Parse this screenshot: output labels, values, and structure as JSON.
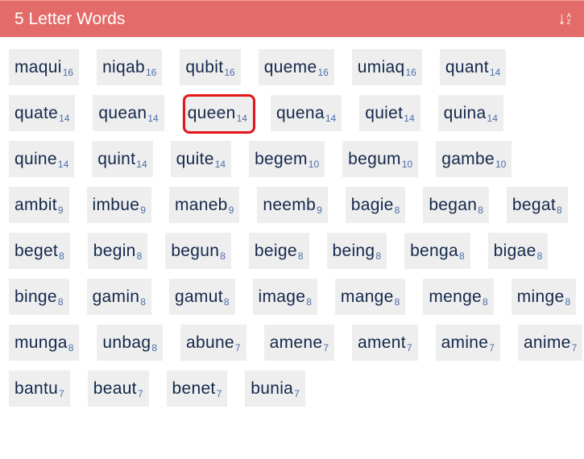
{
  "header": {
    "title": "5 Letter Words",
    "sort_icon": "sort-az-icon",
    "sort_glyph": "↓",
    "sort_letters": [
      "A",
      "Z"
    ]
  },
  "colors": {
    "header_bg": "#e36b69",
    "tile_bg": "#eeeeee",
    "word_text": "#14284b",
    "score_text": "#4b6ea8",
    "highlight": "#e4161b"
  },
  "highlighted_word": "queen",
  "words": [
    {
      "w": "maqui",
      "s": "16"
    },
    {
      "w": "niqab",
      "s": "16"
    },
    {
      "w": "qubit",
      "s": "16"
    },
    {
      "w": "queme",
      "s": "16"
    },
    {
      "w": "umiaq",
      "s": "16"
    },
    {
      "w": "quant",
      "s": "14"
    },
    {
      "w": "quate",
      "s": "14"
    },
    {
      "w": "quean",
      "s": "14"
    },
    {
      "w": "queen",
      "s": "14"
    },
    {
      "w": "quena",
      "s": "14"
    },
    {
      "w": "quiet",
      "s": "14"
    },
    {
      "w": "quina",
      "s": "14"
    },
    {
      "w": "quine",
      "s": "14"
    },
    {
      "w": "quint",
      "s": "14"
    },
    {
      "w": "quite",
      "s": "14"
    },
    {
      "w": "begem",
      "s": "10"
    },
    {
      "w": "begum",
      "s": "10"
    },
    {
      "w": "gambe",
      "s": "10"
    },
    {
      "w": "ambit",
      "s": "9"
    },
    {
      "w": "imbue",
      "s": "9"
    },
    {
      "w": "maneb",
      "s": "9"
    },
    {
      "w": "neemb",
      "s": "9"
    },
    {
      "w": "bagie",
      "s": "8"
    },
    {
      "w": "began",
      "s": "8"
    },
    {
      "w": "begat",
      "s": "8"
    },
    {
      "w": "beget",
      "s": "8"
    },
    {
      "w": "begin",
      "s": "8"
    },
    {
      "w": "begun",
      "s": "8"
    },
    {
      "w": "beige",
      "s": "8"
    },
    {
      "w": "being",
      "s": "8"
    },
    {
      "w": "benga",
      "s": "8"
    },
    {
      "w": "bigae",
      "s": "8"
    },
    {
      "w": "binge",
      "s": "8"
    },
    {
      "w": "gamin",
      "s": "8"
    },
    {
      "w": "gamut",
      "s": "8"
    },
    {
      "w": "image",
      "s": "8"
    },
    {
      "w": "mange",
      "s": "8"
    },
    {
      "w": "menge",
      "s": "8"
    },
    {
      "w": "minge",
      "s": "8"
    },
    {
      "w": "munga",
      "s": "8"
    },
    {
      "w": "unbag",
      "s": "8"
    },
    {
      "w": "abune",
      "s": "7"
    },
    {
      "w": "amene",
      "s": "7"
    },
    {
      "w": "ament",
      "s": "7"
    },
    {
      "w": "amine",
      "s": "7"
    },
    {
      "w": "anime",
      "s": "7"
    },
    {
      "w": "bantu",
      "s": "7"
    },
    {
      "w": "beaut",
      "s": "7"
    },
    {
      "w": "benet",
      "s": "7"
    },
    {
      "w": "bunia",
      "s": "7"
    }
  ]
}
